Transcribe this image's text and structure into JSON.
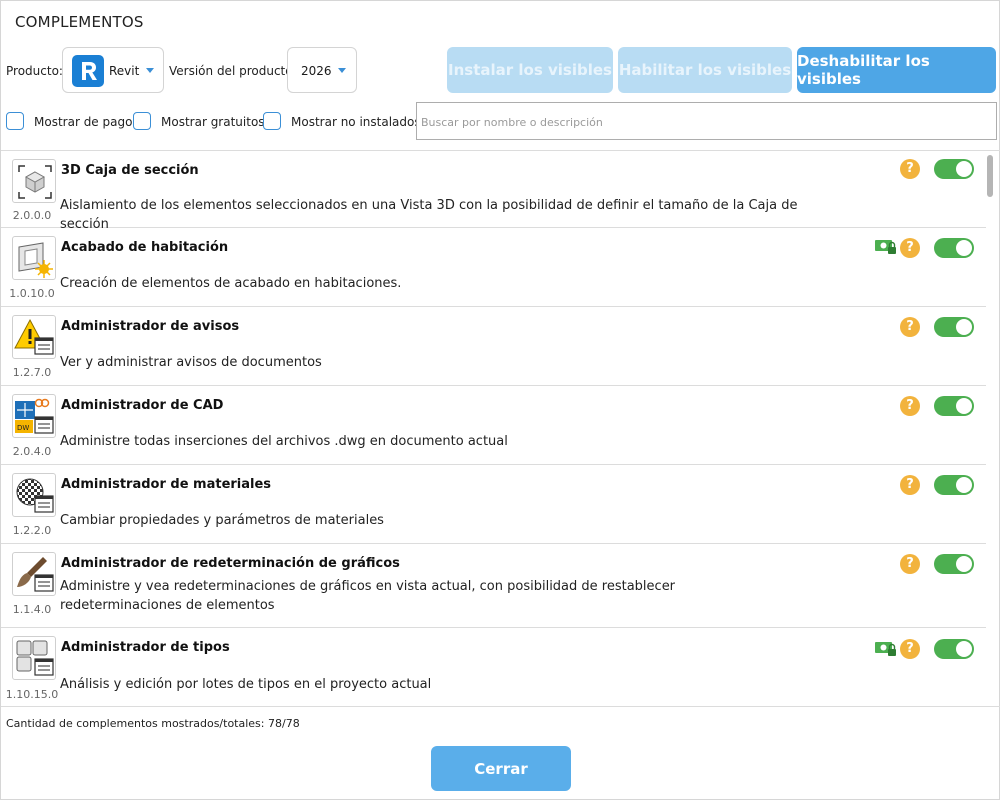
{
  "window": {
    "title": "COMPLEMENTOS"
  },
  "toolbar": {
    "product_label": "Producto:",
    "product_value": "Revit",
    "version_label": "Versión del producto:",
    "version_value": "2026",
    "install_visible": "Instalar los visibles",
    "enable_visible": "Habilitar los visibles",
    "disable_visible": "Deshabilitar los visibles"
  },
  "filters": {
    "show_paid": "Mostrar de pago",
    "show_free": "Mostrar gratuitos",
    "show_not_installed": "Mostrar no instalados",
    "search_placeholder": "Buscar por nombre o descripción"
  },
  "items": [
    {
      "name": "3D Caja de sección",
      "version": "2.0.0.0",
      "description": "Aislamiento de los elementos seleccionados en una Vista 3D con la posibilidad de definir el tamaño de la Caja de sección",
      "icon": "section-box-icon",
      "paid": false,
      "enabled": true
    },
    {
      "name": "Acabado de habitación",
      "version": "1.0.10.0",
      "description": "Creación de elementos de acabado en habitaciones.",
      "icon": "room-finish-icon",
      "paid": true,
      "enabled": true
    },
    {
      "name": "Administrador de avisos",
      "version": "1.2.7.0",
      "description": "Ver y administrar avisos de documentos",
      "icon": "warning-manager-icon",
      "paid": false,
      "enabled": true
    },
    {
      "name": "Administrador de CAD",
      "version": "2.0.4.0",
      "description": "Administre todas inserciones del archivos .dwg en documento actual",
      "icon": "cad-manager-icon",
      "paid": false,
      "enabled": true
    },
    {
      "name": "Administrador de materiales",
      "version": "1.2.2.0",
      "description": "Cambiar propiedades y parámetros de materiales",
      "icon": "material-manager-icon",
      "paid": false,
      "enabled": true
    },
    {
      "name": "Administrador de redeterminación de gráficos",
      "version": "1.1.4.0",
      "description": "Administre y vea redeterminaciones de gráficos en vista actual, con posibilidad de restablecer redeterminaciones de elementos",
      "icon": "graphics-override-icon",
      "paid": false,
      "enabled": true
    },
    {
      "name": "Administrador de tipos",
      "version": "1.10.15.0",
      "description": "Análisis y edición por lotes de tipos en el proyecto actual",
      "icon": "type-manager-icon",
      "paid": true,
      "enabled": true
    }
  ],
  "status": {
    "count_text": "Cantidad de complementos mostrados/totales: 78/78"
  },
  "footer": {
    "close_label": "Cerrar"
  },
  "colors": {
    "accent": "#4ea6e6",
    "toggle_on": "#4caf50",
    "help": "#f2b33d",
    "disabled_button": "#b8dcf3"
  }
}
